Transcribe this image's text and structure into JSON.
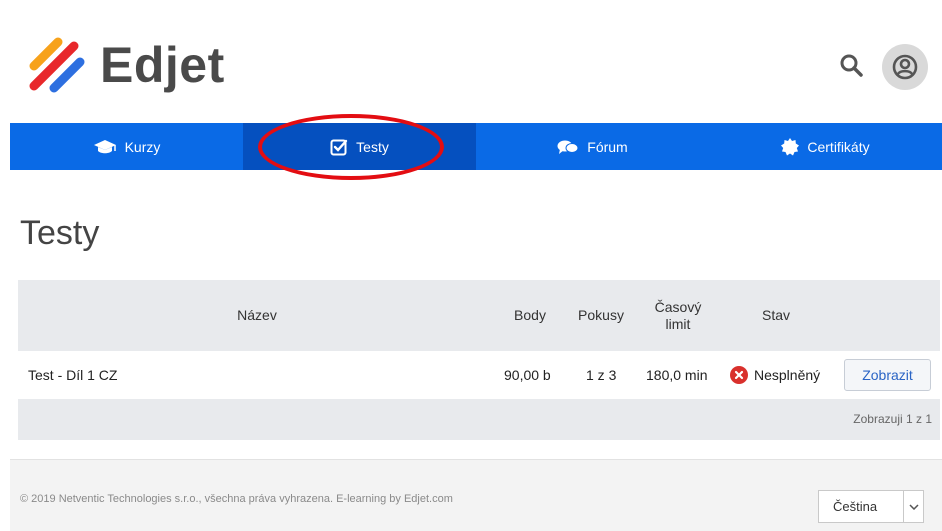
{
  "brand": {
    "name": "Edjet",
    "colors": {
      "accent": "#0a6ae6",
      "active": "#0550bf",
      "orange": "#f7a21b",
      "red": "#e8282b",
      "blue": "#2d6fe0"
    }
  },
  "header": {
    "search_icon": "search-icon",
    "avatar_icon": "user-icon"
  },
  "nav": {
    "items": [
      {
        "label": "Kurzy",
        "icon": "graduation-cap-icon"
      },
      {
        "label": "Testy",
        "icon": "checkbox-icon",
        "active": true
      },
      {
        "label": "Fórum",
        "icon": "chat-bubbles-icon"
      },
      {
        "label": "Certifikáty",
        "icon": "certificate-icon"
      }
    ]
  },
  "page": {
    "title": "Testy"
  },
  "table": {
    "columns": {
      "name": "Název",
      "points": "Body",
      "attempts": "Pokusy",
      "time_line1": "Časový",
      "time_line2": "limit",
      "status": "Stav"
    },
    "rows": [
      {
        "name": "Test - Díl 1 CZ",
        "points": "90,00 b",
        "attempts": "1 z 3",
        "time_limit": "180,0 min",
        "status": "Nesplněný",
        "action": "Zobrazit"
      }
    ],
    "paging": "Zobrazuji 1 z 1"
  },
  "footer": {
    "copyright": "© 2019 Netventic Technologies s.r.o., všechna práva vyhrazena. E-learning by Edjet.com",
    "language": "Čeština"
  }
}
